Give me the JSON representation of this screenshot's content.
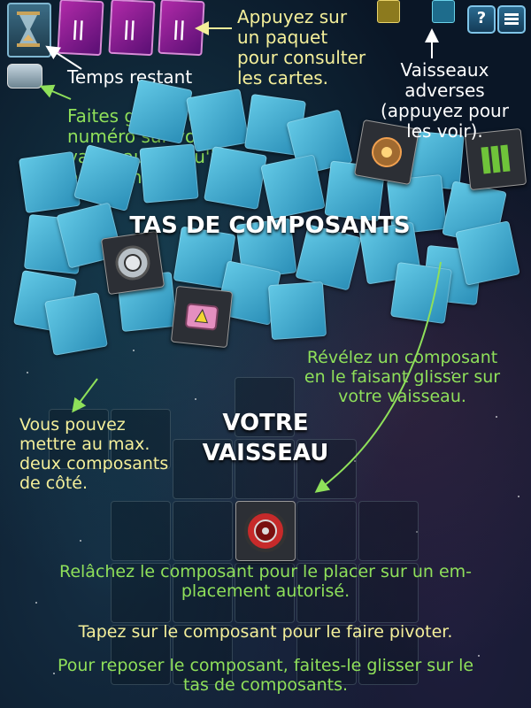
{
  "colors": {
    "background": "#0a1626",
    "tile": "#4fb4d8",
    "card_purple": "#a023a4",
    "hint_yellow": "#f4ef9a",
    "hint_green": "#8fe05a",
    "text_white": "#ffffff"
  },
  "top_bar": {
    "hourglass_icon": "hourglass-icon",
    "card_deck_count": 3,
    "help_label": "?",
    "menu_icon": "hamburger-icon"
  },
  "hints": {
    "time_remaining": "Temps restant",
    "deck_hint": [
      "Appuyez sur",
      "un paquet",
      "pour consulter",
      "les cartes."
    ],
    "drag_number": [
      "Faites glisser un",
      "numéro sur votre",
      "vaisseau lorsqu'il",
      "est terminé."
    ],
    "opponents": [
      "Vaisseaux",
      "adverses",
      "(appuyez pour",
      "les voir)."
    ],
    "reveal": [
      "Révélez un composant",
      "en le faisant glisser sur",
      "votre vaisseau."
    ],
    "side_components": [
      "Vous pouvez",
      "mettre au max.",
      "deux composants",
      "de côté."
    ],
    "release": "Relâchez le composant pour le placer sur un em-placement autorisé.",
    "release_lines": [
      "Relâchez le composant pour le placer sur un em-",
      "placement autorisé."
    ],
    "rotate": "Tapez sur le composant pour le faire pivoter.",
    "return_lines": [
      "Pour reposer le composant, faites-le glisser sur le",
      "tas de composants."
    ]
  },
  "headings": {
    "pile": "TAS DE COMPOSANTS",
    "ship_line1": "VOTRE",
    "ship_line2": "VAISSEAU"
  }
}
